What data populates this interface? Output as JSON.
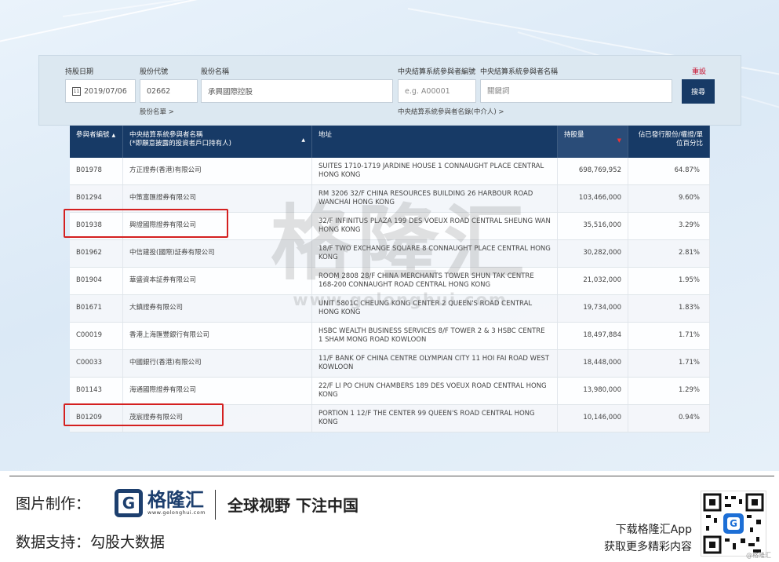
{
  "filters": {
    "date_label": "持股日期",
    "code_label": "股份代號",
    "name_label": "股份名稱",
    "participant_id_label": "中央結算系統參與者編號",
    "participant_name_label": "中央結算系統參與者名稱",
    "reset_label": "重設",
    "date_value": "2019/07/06",
    "code_value": "02662",
    "name_value": "承興國際控股",
    "participant_id_placeholder": "e.g. A00001",
    "participant_name_placeholder": "關鍵詞",
    "search_label": "搜尋",
    "stock_list_link": "股份名單 >",
    "participant_list_link": "中央結算系統參與者名錄(中介人) >"
  },
  "table": {
    "headers": {
      "id": "參與者編號",
      "name_line1": "中央結算系統參與者名稱",
      "name_line2": "(*即願意披露的投資者戶口持有人)",
      "address": "地址",
      "holding": "持股量",
      "percent": "佔已發行股份/權證/單位百分比"
    },
    "rows": [
      {
        "id": "B01978",
        "name": "方正證券(香港)有限公司",
        "address": "SUITES 1710-1719 JARDINE HOUSE 1 CONNAUGHT PLACE CENTRAL HONG KONG",
        "holding": "698,769,952",
        "percent": "64.87%"
      },
      {
        "id": "B01294",
        "name": "中策富匯證券有限公司",
        "address": "RM 3206 32/F CHINA RESOURCES BUILDING 26 HARBOUR ROAD WANCHAI HONG KONG",
        "holding": "103,466,000",
        "percent": "9.60%"
      },
      {
        "id": "B01938",
        "name": "興證國際證券有限公司",
        "address": "32/F INFINITUS PLAZA 199 DES VOEUX ROAD CENTRAL SHEUNG WAN HONG KONG",
        "holding": "35,516,000",
        "percent": "3.29%"
      },
      {
        "id": "B01962",
        "name": "中信建投(國際)証券有限公司",
        "address": "18/F TWO EXCHANGE SQUARE 8 CONNAUGHT PLACE CENTRAL HONG KONG",
        "holding": "30,282,000",
        "percent": "2.81%"
      },
      {
        "id": "B01904",
        "name": "華盛資本証券有限公司",
        "address": "ROOM 2808 28/F CHINA MERCHANTS TOWER SHUN TAK CENTRE 168-200 CONNAUGHT ROAD CENTRAL HONG KONG",
        "holding": "21,032,000",
        "percent": "1.95%"
      },
      {
        "id": "B01671",
        "name": "大鎮證券有限公司",
        "address": "UNIT 5801C CHEUNG KONG CENTER 2 QUEEN'S ROAD CENTRAL HONG KONG",
        "holding": "19,734,000",
        "percent": "1.83%"
      },
      {
        "id": "C00019",
        "name": "香港上海匯豐銀行有限公司",
        "address": "HSBC WEALTH BUSINESS SERVICES 8/F TOWER 2 & 3 HSBC CENTRE 1 SHAM MONG ROAD KOWLOON",
        "holding": "18,497,884",
        "percent": "1.71%"
      },
      {
        "id": "C00033",
        "name": "中國銀行(香港)有限公司",
        "address": "11/F BANK OF CHINA CENTRE OLYMPIAN CITY 11 HOI FAI ROAD WEST KOWLOON",
        "holding": "18,448,000",
        "percent": "1.71%"
      },
      {
        "id": "B01143",
        "name": "海通國際證券有限公司",
        "address": "22/F LI PO CHUN CHAMBERS 189 DES VOEUX ROAD CENTRAL HONG KONG",
        "holding": "13,980,000",
        "percent": "1.29%"
      },
      {
        "id": "B01209",
        "name": "茂宸證券有限公司",
        "address": "PORTION 1 12/F THE CENTER 99 QUEEN'S ROAD CENTRAL HONG KONG",
        "holding": "10,146,000",
        "percent": "0.94%"
      }
    ]
  },
  "watermark": {
    "logo": "格隆汇",
    "url": "www.gelonghui.com"
  },
  "footer": {
    "made_by_label": "图片制作：",
    "data_label": "数据支持：勾股大数据",
    "brand_letter": "G",
    "brand_name": "格隆汇",
    "brand_url": "www.gelonghui.com",
    "slogan": "全球视野 下注中国",
    "download_line1": "下载格隆汇App",
    "download_line2": "获取更多精彩内容",
    "qr_mark": "@格隆汇"
  },
  "colors": {
    "header_bg": "#173a66",
    "highlight": "#d42020",
    "brand": "#1d3f6e"
  }
}
